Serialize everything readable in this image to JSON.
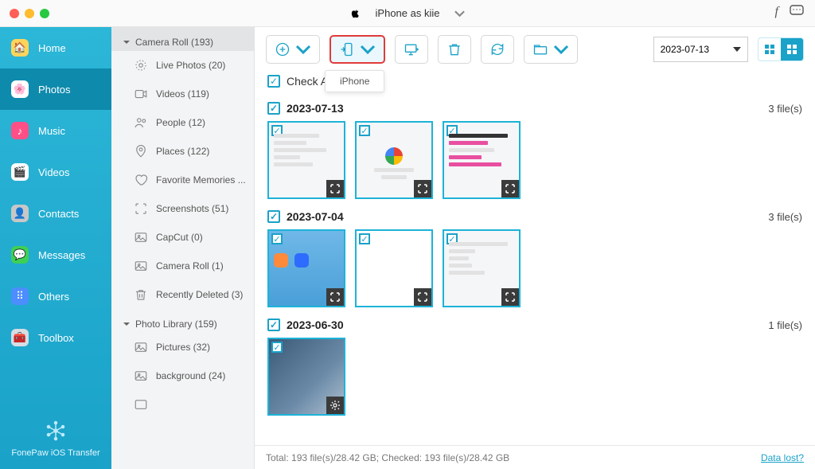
{
  "title": {
    "device": "iPhone as kiie"
  },
  "sidebar": {
    "items": [
      {
        "label": "Home"
      },
      {
        "label": "Photos"
      },
      {
        "label": "Music"
      },
      {
        "label": "Videos"
      },
      {
        "label": "Contacts"
      },
      {
        "label": "Messages"
      },
      {
        "label": "Others"
      },
      {
        "label": "Toolbox"
      }
    ],
    "brand": "FonePaw iOS Transfer"
  },
  "categories": {
    "groups": [
      {
        "label": "Camera Roll (193)",
        "items": [
          {
            "label": "Live Photos (20)"
          },
          {
            "label": "Videos (119)"
          },
          {
            "label": "People (12)"
          },
          {
            "label": "Places (122)"
          },
          {
            "label": "Favorite Memories ..."
          },
          {
            "label": "Screenshots (51)"
          },
          {
            "label": "CapCut (0)"
          },
          {
            "label": "Camera Roll (1)"
          },
          {
            "label": "Recently Deleted (3)"
          }
        ]
      },
      {
        "label": "Photo Library (159)",
        "items": [
          {
            "label": "Pictures (32)"
          },
          {
            "label": "background (24)"
          }
        ]
      }
    ]
  },
  "toolbar": {
    "import_tooltip": "iPhone",
    "date": "2023-07-13"
  },
  "checkall": {
    "label": "Check All(193)"
  },
  "groups": [
    {
      "date": "2023-07-13",
      "count": "3 file(s)"
    },
    {
      "date": "2023-07-04",
      "count": "3 file(s)"
    },
    {
      "date": "2023-06-30",
      "count": "1 file(s)"
    }
  ],
  "footer": {
    "status": "Total: 193 file(s)/28.42 GB; Checked: 193 file(s)/28.42 GB",
    "link": "Data lost?"
  }
}
